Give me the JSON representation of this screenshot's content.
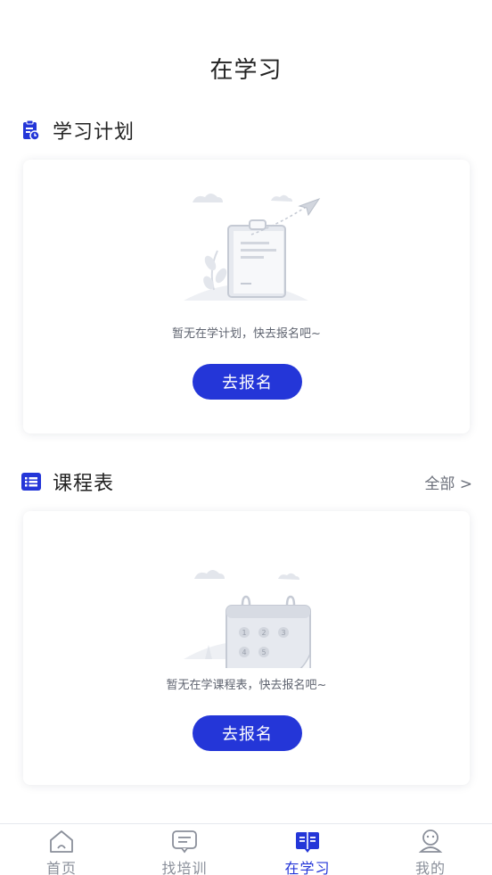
{
  "header": {
    "title": "在学习"
  },
  "study_plan": {
    "title": "学习计划",
    "empty_text": "暂无在学计划，快去报名吧~",
    "button": "去报名"
  },
  "schedule": {
    "title": "课程表",
    "more": "全部 >",
    "empty_text": "暂无在学课程表，快去报名吧~",
    "button": "去报名",
    "calendar_numbers": [
      "1",
      "2",
      "3",
      "4",
      "5"
    ]
  },
  "tabs": [
    {
      "label": "首页",
      "icon": "home-icon",
      "active": false
    },
    {
      "label": "找培训",
      "icon": "message-icon",
      "active": false
    },
    {
      "label": "在学习",
      "icon": "book-icon",
      "active": true
    },
    {
      "label": "我的",
      "icon": "profile-icon",
      "active": false
    }
  ],
  "colors": {
    "accent": "#2436d8",
    "text": "#222222",
    "muted": "#8a8f9a"
  }
}
